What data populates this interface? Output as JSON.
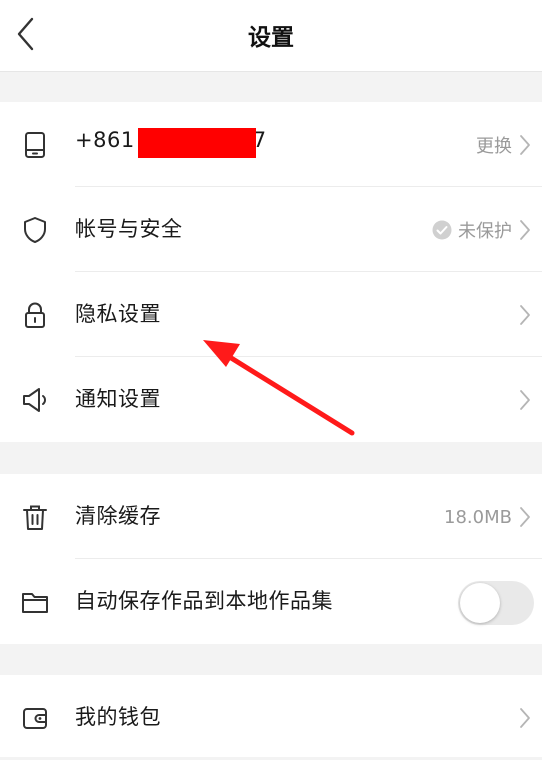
{
  "header": {
    "title": "设置"
  },
  "groups": [
    {
      "items": [
        {
          "label": "+861",
          "label_tail": "7",
          "value": "更换"
        },
        {
          "label": "帐号与安全",
          "value": "未保护"
        },
        {
          "label": "隐私设置"
        },
        {
          "label": "通知设置"
        }
      ]
    },
    {
      "items": [
        {
          "label": "清除缓存",
          "value": "18.0MB"
        },
        {
          "label": "自动保存作品到本地作品集",
          "toggle_on": false
        }
      ]
    },
    {
      "items": [
        {
          "label": "我的钱包"
        }
      ]
    }
  ],
  "colors": {
    "annotation_arrow": "#ff1a1a",
    "redaction": "#ff0000"
  }
}
